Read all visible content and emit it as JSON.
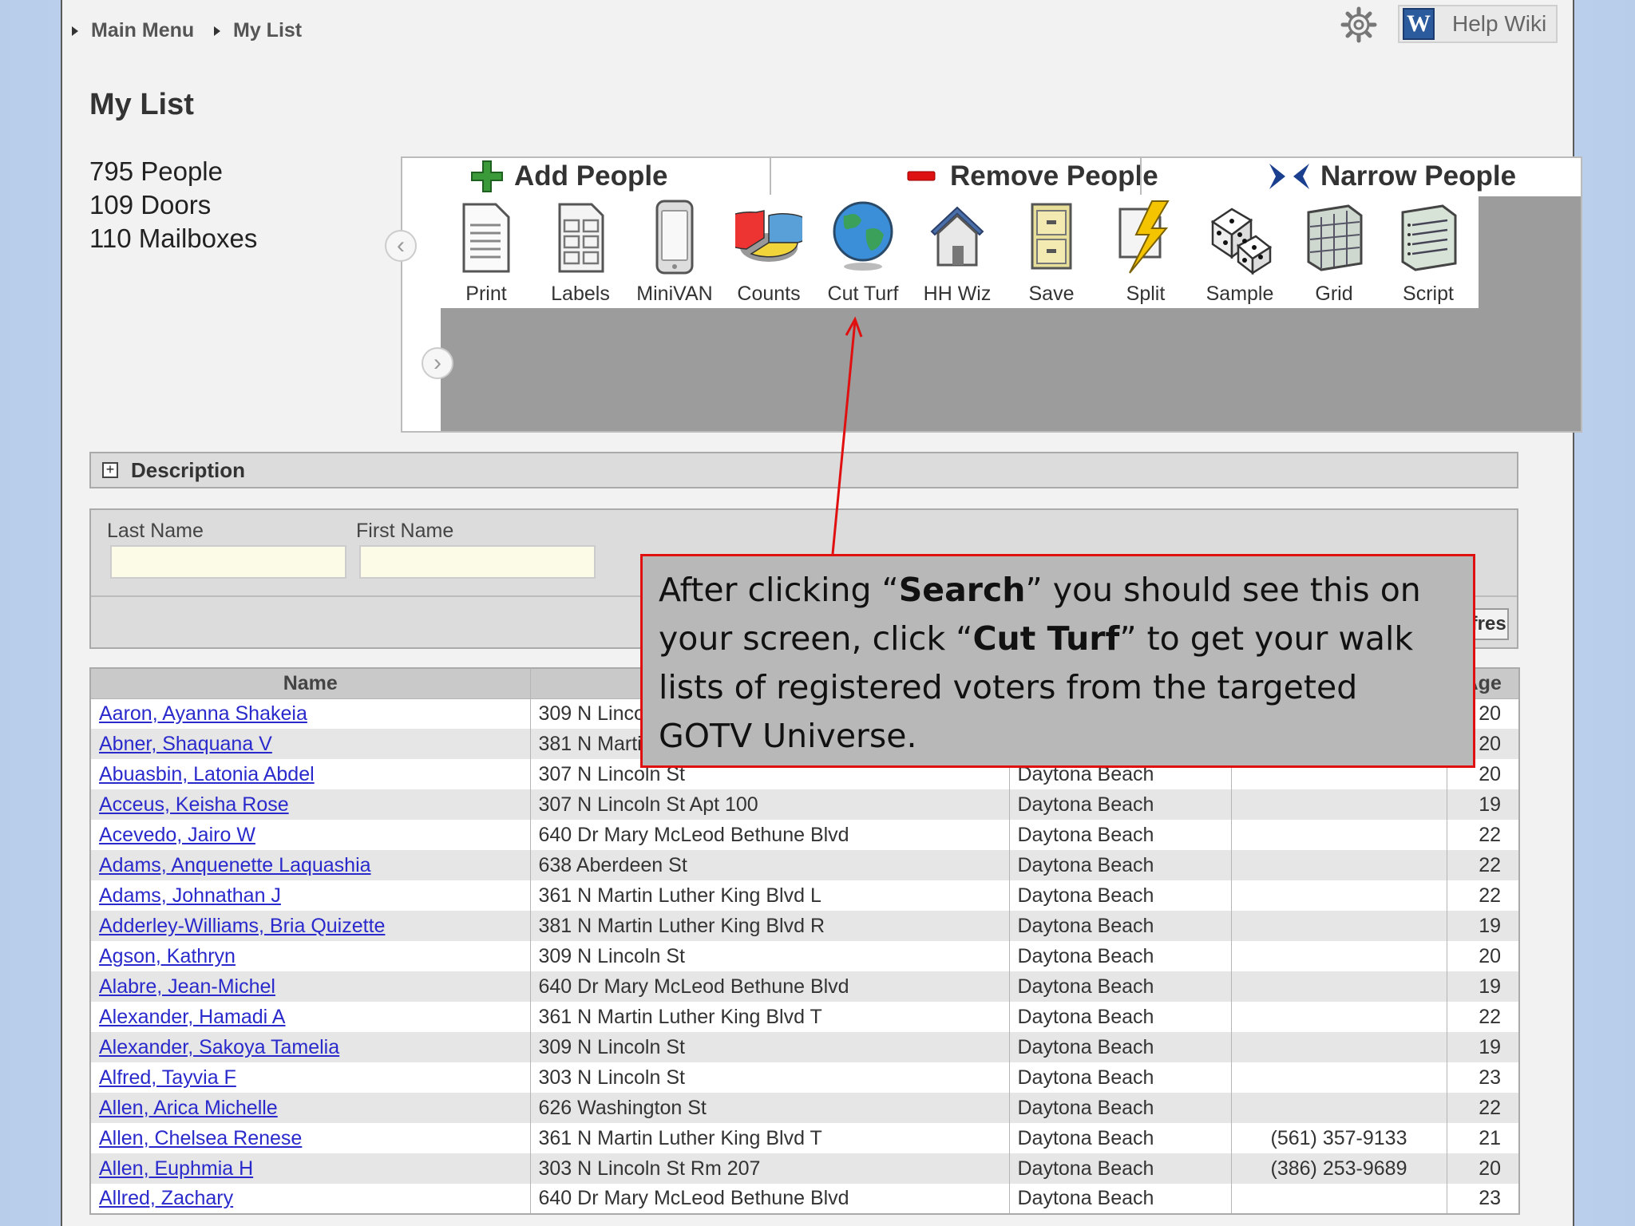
{
  "breadcrumb": {
    "items": [
      "Main Menu",
      "My List"
    ]
  },
  "help": {
    "logo": "W",
    "label": "Help Wiki"
  },
  "page_title": "My List",
  "counts": {
    "people": "795 People",
    "doors": "109 Doors",
    "mailboxes": "110 Mailboxes"
  },
  "toolbar": {
    "tabs": {
      "add": "Add People",
      "remove": "Remove People",
      "narrow": "Narrow People"
    },
    "tools": [
      "Print",
      "Labels",
      "MiniVAN",
      "Counts",
      "Cut Turf",
      "HH Wiz",
      "Save",
      "Split",
      "Sample",
      "Grid",
      "Script"
    ],
    "prev": "‹",
    "next": "›"
  },
  "description": {
    "label": "Description",
    "toggle": "+"
  },
  "filter": {
    "last_name_label": "Last Name",
    "first_name_label": "First Name",
    "last_name_value": "",
    "first_name_value": "",
    "refresh_label": "Refresh"
  },
  "table": {
    "headers": {
      "name": "Name",
      "address": "",
      "city": "",
      "phone": "",
      "age": "Age"
    },
    "rows": [
      {
        "name": "Aaron, Ayanna Shakeia",
        "address": "309 N Lincoln St",
        "city": "",
        "phone": "",
        "age": "20"
      },
      {
        "name": "Abner, Shaquana V",
        "address": "381 N Martin Luther King Blvd",
        "city": "",
        "phone": "",
        "age": "20"
      },
      {
        "name": "Abuasbin, Latonia Abdel",
        "address": "307 N Lincoln St",
        "city": "Daytona Beach",
        "phone": "",
        "age": "20"
      },
      {
        "name": "Acceus, Keisha Rose",
        "address": "307 N Lincoln St Apt 100",
        "city": "Daytona Beach",
        "phone": "",
        "age": "19"
      },
      {
        "name": "Acevedo, Jairo W",
        "address": "640 Dr Mary McLeod Bethune Blvd",
        "city": "Daytona Beach",
        "phone": "",
        "age": "22"
      },
      {
        "name": "Adams, Anquenette Laquashia",
        "address": "638 Aberdeen St",
        "city": "Daytona Beach",
        "phone": "",
        "age": "22"
      },
      {
        "name": "Adams, Johnathan J",
        "address": "361 N Martin Luther King Blvd L",
        "city": "Daytona Beach",
        "phone": "",
        "age": "22"
      },
      {
        "name": "Adderley-Williams, Bria Quizette",
        "address": "381 N Martin Luther King Blvd R",
        "city": "Daytona Beach",
        "phone": "",
        "age": "19"
      },
      {
        "name": "Agson, Kathryn",
        "address": "309 N Lincoln St",
        "city": "Daytona Beach",
        "phone": "",
        "age": "20"
      },
      {
        "name": "Alabre, Jean-Michel",
        "address": "640 Dr Mary McLeod Bethune Blvd",
        "city": "Daytona Beach",
        "phone": "",
        "age": "19"
      },
      {
        "name": "Alexander, Hamadi A",
        "address": "361 N Martin Luther King Blvd T",
        "city": "Daytona Beach",
        "phone": "",
        "age": "22"
      },
      {
        "name": "Alexander, Sakoya Tamelia",
        "address": "309 N Lincoln St",
        "city": "Daytona Beach",
        "phone": "",
        "age": "19"
      },
      {
        "name": "Alfred, Tayvia F",
        "address": "303 N Lincoln St",
        "city": "Daytona Beach",
        "phone": "",
        "age": "23"
      },
      {
        "name": "Allen, Arica Michelle",
        "address": "626 Washington St",
        "city": "Daytona Beach",
        "phone": "",
        "age": "22"
      },
      {
        "name": "Allen, Chelsea Renese",
        "address": "361 N Martin Luther King Blvd T",
        "city": "Daytona Beach",
        "phone": "(561) 357-9133",
        "age": "21"
      },
      {
        "name": "Allen, Euphmia H",
        "address": "303 N Lincoln St Rm 207",
        "city": "Daytona Beach",
        "phone": "(386) 253-9689",
        "age": "20"
      },
      {
        "name": "Allred, Zachary",
        "address": "640 Dr Mary McLeod Bethune Blvd",
        "city": "Daytona Beach",
        "phone": "",
        "age": "23"
      }
    ]
  },
  "callout": {
    "t1": "After clicking “",
    "b1": "Search",
    "t2": "” you should see this on your screen, click  “",
    "b2": "Cut Turf",
    "t3": "” to get your walk lists of registered voters from the targeted GOTV Universe."
  },
  "colors": {
    "callout_border": "#e01010",
    "link": "#2a2acc",
    "add_icon": "#2e8b2e",
    "remove_icon": "#cc1111",
    "narrow_icon": "#1b3f8f"
  }
}
